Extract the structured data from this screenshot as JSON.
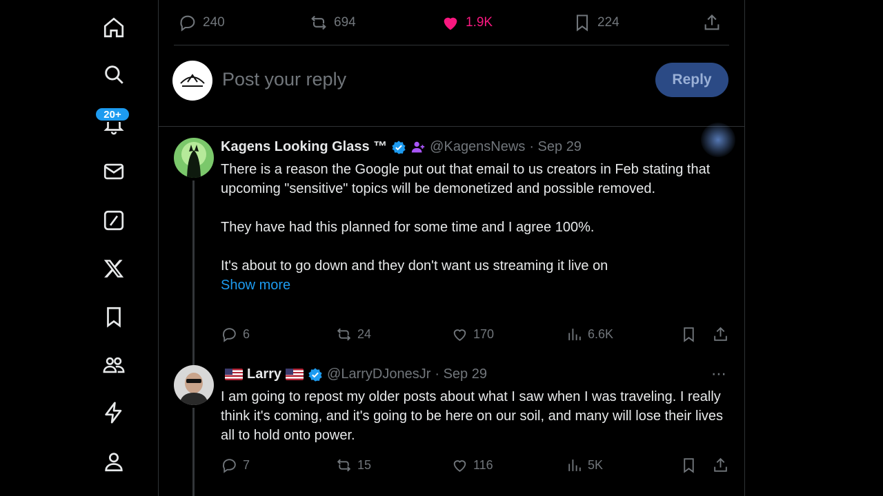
{
  "sidebar": {
    "items": [
      {
        "name": "home-icon"
      },
      {
        "name": "search-icon"
      },
      {
        "name": "bell-icon"
      },
      {
        "name": "mail-icon"
      },
      {
        "name": "grok-icon"
      },
      {
        "name": "x-logo-icon"
      },
      {
        "name": "bookmark-icon"
      },
      {
        "name": "communities-icon"
      },
      {
        "name": "lightning-icon"
      },
      {
        "name": "profile-icon"
      }
    ],
    "notification_badge": "20+"
  },
  "main_post_actions": {
    "replies": "240",
    "reposts": "694",
    "likes": "1.9K",
    "bookmarks": "224"
  },
  "reply_composer": {
    "placeholder": "Post your reply",
    "button_label": "Reply"
  },
  "replies": [
    {
      "name": "Kagens Looking Glass ™",
      "handle": "@KagensNews",
      "date": "· Sep 29",
      "paragraphs": [
        "There is a reason the Google put out that email to us creators in Feb stating that upcoming \"sensitive\" topics will be demonetized and possible removed.",
        "They have had this planned for some time and I agree 100%.",
        "It's about to go down and they don't want us streaming it live on"
      ],
      "show_more": "Show more",
      "replies": "6",
      "reposts": "24",
      "likes": "170",
      "views": "6.6K"
    },
    {
      "name": "Larry",
      "handle": "@LarryDJonesJr",
      "date": "· Sep 29",
      "paragraphs": [
        "I am going to repost my older posts about what I saw when I was traveling. I really think it's coming, and it's going to be here on our soil, and many will lose their lives all to hold onto power."
      ],
      "replies": "7",
      "reposts": "15",
      "likes": "116",
      "views": "5K"
    }
  ],
  "colors": {
    "background": "#000000",
    "accent": "#1d9bf0",
    "like": "#f91880",
    "muted": "#71767b",
    "border": "#2f3336"
  }
}
